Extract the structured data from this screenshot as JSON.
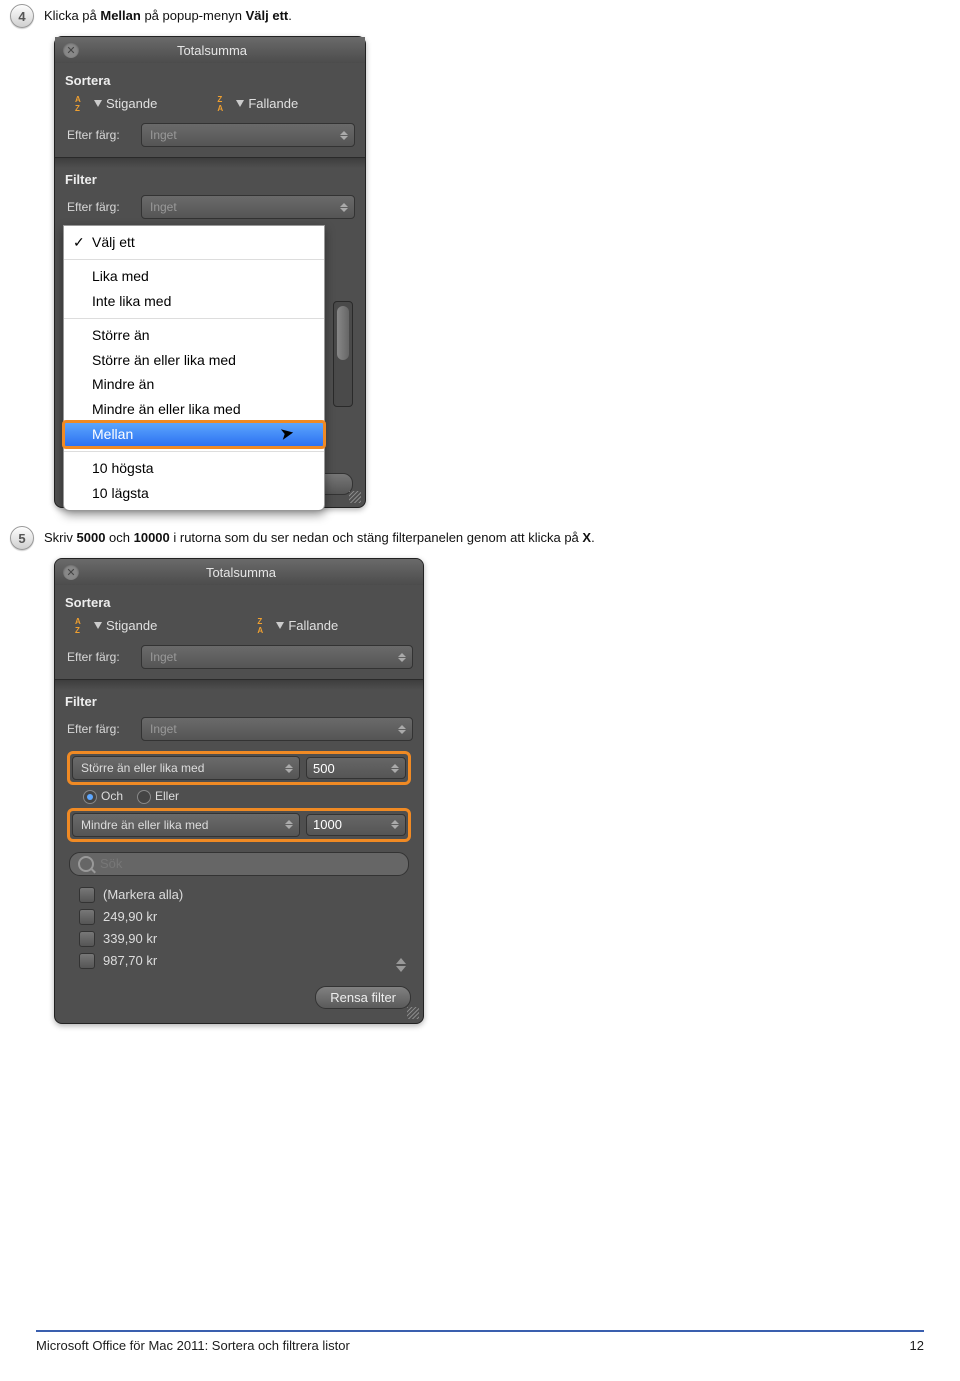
{
  "step4": {
    "num": "4",
    "text_prefix": "Klicka på ",
    "text_bold1": "Mellan",
    "text_mid": " på popup-menyn ",
    "text_bold2": "Välj ett",
    "text_suffix": "."
  },
  "panel1": {
    "title": "Totalsumma",
    "sortera": "Sortera",
    "stigande": "Stigande",
    "fallande": "Fallande",
    "efter_farg": "Efter färg:",
    "inget": "Inget",
    "filter": "Filter",
    "dropdown": {
      "items_top": [
        "Välj ett"
      ],
      "items_g1": [
        "Lika med",
        "Inte lika med"
      ],
      "items_g2": [
        "Större än",
        "Större än eller lika med",
        "Mindre än",
        "Mindre än eller lika med"
      ],
      "highlight": "Mellan",
      "items_bottom": [
        "10 högsta",
        "10 lägsta"
      ]
    }
  },
  "step5": {
    "num": "5",
    "text_prefix": "Skriv ",
    "text_bold1": "5000",
    "text_mid1": " och ",
    "text_bold2": "10000",
    "text_mid2": " i rutorna som du ser nedan och stäng filterpanelen genom att klicka på ",
    "text_bold3": "X",
    "text_suffix": "."
  },
  "panel2": {
    "title": "Totalsumma",
    "sortera": "Sortera",
    "stigande": "Stigande",
    "fallande": "Fallande",
    "efter_farg": "Efter färg:",
    "inget": "Inget",
    "filter": "Filter",
    "cond1": "Större än eller lika med",
    "val1": "500",
    "och": "Och",
    "eller": "Eller",
    "cond2": "Mindre än eller lika med",
    "val2": "1000",
    "search_placeholder": "Sök",
    "check_all": "(Markera alla)",
    "check_items": [
      "249,90 kr",
      "339,90 kr",
      "987,70 kr"
    ],
    "clear": "Rensa filter"
  },
  "footer": {
    "left": "Microsoft Office för Mac 2011: Sortera och filtrera listor",
    "right": "12"
  }
}
